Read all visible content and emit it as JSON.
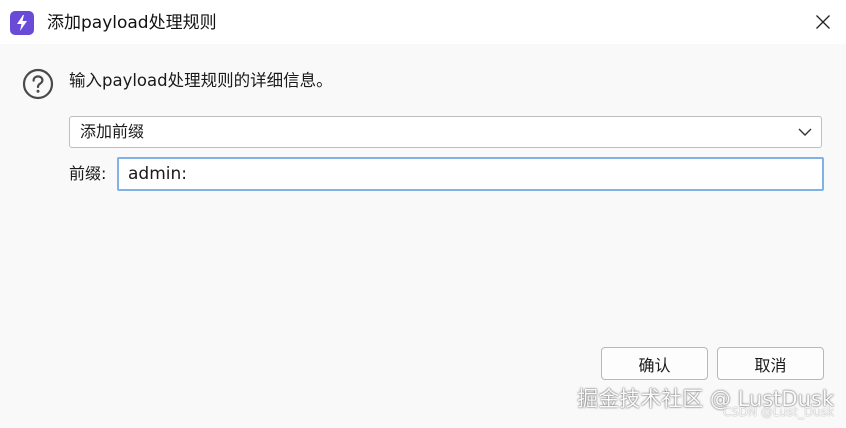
{
  "window": {
    "title": "添加payload处理规则"
  },
  "dialog": {
    "message": "输入payload处理规则的详细信息。",
    "rule_type": {
      "selected": "添加前缀"
    },
    "prefix": {
      "label": "前缀:",
      "value": "admin:"
    },
    "buttons": {
      "ok": "确认",
      "cancel": "取消"
    }
  },
  "watermark": {
    "main": "掘金技术社区 @ LustDusk",
    "small": "CSDN @Lust_Dusk"
  },
  "colors": {
    "app_icon": "#6a4bd8",
    "input_focus_border": "#7fb2e6"
  },
  "icons": [
    "app-lightning-icon",
    "close-icon",
    "help-question-icon",
    "chevron-down-icon"
  ]
}
